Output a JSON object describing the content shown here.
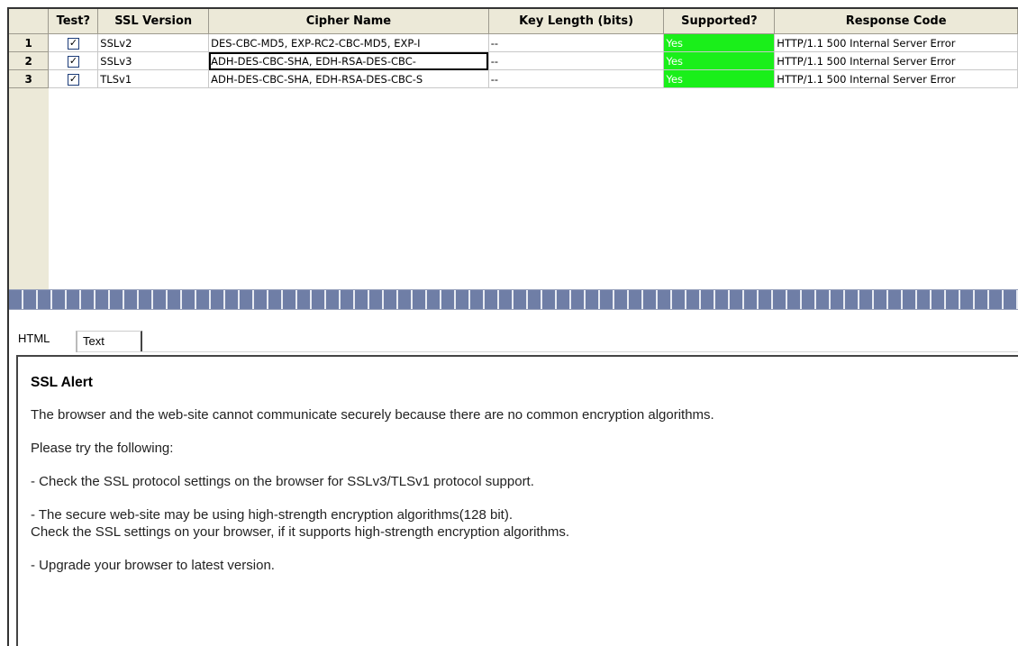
{
  "table": {
    "headers": [
      "",
      "Test?",
      "SSL Version",
      "Cipher Name",
      "Key Length (bits)",
      "Supported?",
      "Response Code"
    ],
    "rows": [
      {
        "num": "1",
        "test_checked": true,
        "ssl_version": "SSLv2",
        "cipher": "DES-CBC-MD5, EXP-RC2-CBC-MD5, EXP-I",
        "key_length": "--",
        "supported": "Yes",
        "response": "HTTP/1.1 500 Internal Server Error"
      },
      {
        "num": "2",
        "test_checked": true,
        "ssl_version": "SSLv3",
        "cipher": "ADH-DES-CBC-SHA, EDH-RSA-DES-CBC-",
        "key_length": "--",
        "supported": "Yes",
        "response": "HTTP/1.1 500 Internal Server Error"
      },
      {
        "num": "3",
        "test_checked": true,
        "ssl_version": "TLSv1",
        "cipher": "ADH-DES-CBC-SHA, EDH-RSA-DES-CBC-S",
        "key_length": "--",
        "supported": "Yes",
        "response": "HTTP/1.1 500 Internal Server Error"
      }
    ],
    "checkbox_glyph": "✓",
    "supported_color": "#1aef1a"
  },
  "tabs": {
    "html_label": "HTML",
    "text_label": "Text",
    "active": "HTML"
  },
  "content": {
    "title": "SSL Alert",
    "line1": "The browser and the web-site cannot communicate securely because there are no common encryption algorithms.",
    "line2": "Please try the following:",
    "line3": "- Check the SSL protocol settings on the browser for SSLv3/TLSv1 protocol support.",
    "line4a": "- The secure web-site may be using high-strength encryption algorithms(128 bit).",
    "line4b": "Check the SSL settings on your browser, if it supports high-strength encryption algorithms.",
    "line5": "- Upgrade your browser to latest version."
  }
}
